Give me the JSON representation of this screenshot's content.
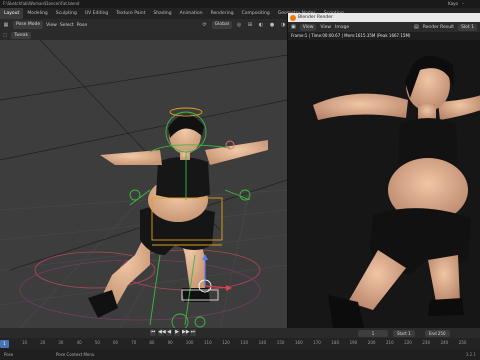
{
  "window": {
    "title": "F:\\Sketchfab\\Woman\\Dancer\\Fat.blend",
    "user_label": "Kayo",
    "minimize_glyph": "–"
  },
  "workspace_tabs": [
    {
      "label": "Layout",
      "active": true
    },
    {
      "label": "Modeling",
      "active": false
    },
    {
      "label": "Sculpting",
      "active": false
    },
    {
      "label": "UV Editing",
      "active": false
    },
    {
      "label": "Texture Paint",
      "active": false
    },
    {
      "label": "Shading",
      "active": false
    },
    {
      "label": "Animation",
      "active": false
    },
    {
      "label": "Rendering",
      "active": false
    },
    {
      "label": "Compositing",
      "active": false
    },
    {
      "label": "Geometry Nodes",
      "active": false
    },
    {
      "label": "Scripting",
      "active": false
    }
  ],
  "viewport_header": {
    "mode": "Pose Mode",
    "orientation": "Global",
    "menus": [
      "View",
      "Select",
      "Pose"
    ]
  },
  "viewport_tools": {
    "transform_label": "Tweak"
  },
  "render_window": {
    "title": "Blender Render",
    "menus": [
      "View",
      "View",
      "Image"
    ],
    "slot": "Slot 1",
    "layer": "Render Result",
    "info": "Frame:1 | Time:00:00.67 | Mem:1615.35M (Peak 1667.15M)"
  },
  "timeline": {
    "current_frame": "1",
    "start_label": "Start",
    "start_value": "1",
    "end_label": "End",
    "end_value": "250",
    "ruler_ticks": [
      "10",
      "20",
      "30",
      "40",
      "50",
      "60",
      "70",
      "80",
      "90",
      "100",
      "110",
      "120",
      "130",
      "140",
      "150",
      "160",
      "170",
      "180",
      "190",
      "200",
      "210",
      "220",
      "230",
      "240",
      "250"
    ],
    "playback_glyphs": [
      "⏮",
      "◀◀",
      "◀",
      "▶",
      "▶▶",
      "⏭"
    ]
  },
  "status_bar": {
    "mode": "Pose",
    "hint": "Pose Context Menu",
    "version": "3.2.1"
  },
  "colors": {
    "accent": "#4772b3",
    "viewport_bg": "#3d3d3d",
    "render_bg": "#161616",
    "bone_green": "#3fb83f",
    "bone_orange": "#e0a020"
  }
}
